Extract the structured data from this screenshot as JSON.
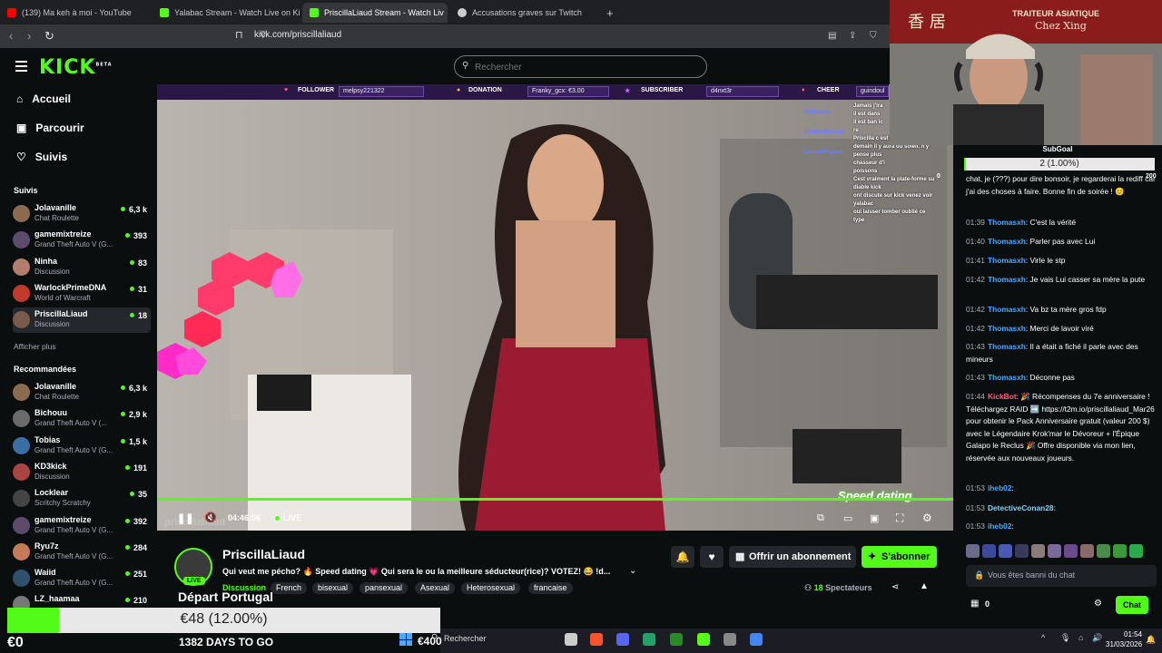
{
  "browser": {
    "tabs": [
      {
        "label": "(139) Ma keh à moi - YouTube",
        "color": "#ff0000"
      },
      {
        "label": "Yalabac Stream - Watch Live on Kick",
        "color": "#53fc18"
      },
      {
        "label": "PriscillaLiaud Stream - Watch Liv",
        "color": "#53fc18"
      },
      {
        "label": "Accusations graves sur Twitch",
        "color": "#cccccc"
      }
    ],
    "url": "kick.com/priscillaliaud"
  },
  "kick": {
    "logo": "KICK",
    "logo_beta": "BETA",
    "search_placeholder": "Rechercher",
    "nav": {
      "home": "Accueil",
      "browse": "Parcourir",
      "following": "Suivis"
    },
    "following_title": "Suivis",
    "show_more": "Afficher plus",
    "recommended_title": "Recommandées",
    "following": [
      {
        "name": "Jolavanille",
        "game": "Chat Roulette",
        "viewers": "6,3 k",
        "color": "#8b6b4f"
      },
      {
        "name": "gamemixtreize",
        "game": "Grand Theft Auto V (G...",
        "viewers": "393",
        "color": "#5d4b6e"
      },
      {
        "name": "Ninha",
        "game": "Discussion",
        "viewers": "83",
        "color": "#b07e6a"
      },
      {
        "name": "WarlockPrimeDNA",
        "game": "World of Warcraft",
        "viewers": "31",
        "color": "#c0392b"
      },
      {
        "name": "PriscillaLiaud",
        "game": "Discussion",
        "viewers": "18",
        "color": "#7a5a4a"
      }
    ],
    "recommended": [
      {
        "name": "Jolavanille",
        "game": "Chat Roulette",
        "viewers": "6,3 k",
        "color": "#8b6b4f"
      },
      {
        "name": "Bichouu",
        "game": "Grand Theft Auto V (...",
        "viewers": "2,9 k",
        "color": "#6b6b6b"
      },
      {
        "name": "Tobias",
        "game": "Grand Theft Auto V (G...",
        "viewers": "1,5 k",
        "color": "#3a6ea5"
      },
      {
        "name": "KD3kick",
        "game": "Discussion",
        "viewers": "191",
        "color": "#a94442"
      },
      {
        "name": "Locklear",
        "game": "Scritchy Scratchy",
        "viewers": "35",
        "color": "#444"
      },
      {
        "name": "gamemixtreize",
        "game": "Grand Theft Auto V (G...",
        "viewers": "392",
        "color": "#5d4b6e"
      },
      {
        "name": "Ryu7z",
        "game": "Grand Theft Auto V (G...",
        "viewers": "284",
        "color": "#c57b57"
      },
      {
        "name": "Waiid",
        "game": "Grand Theft Auto V (G...",
        "viewers": "251",
        "color": "#2f4f6f"
      },
      {
        "name": "LZ_haamaa",
        "game": "",
        "viewers": "210",
        "color": "#777"
      }
    ]
  },
  "video": {
    "alerts": {
      "follower_label": "FOLLOWER",
      "follower_value": "melpsy221322",
      "donation_label": "DONATION",
      "donation_value": "Franky_gcx: €3.00",
      "subscriber_label": "SUBSCRIBER",
      "subscriber_value": "d4nxt3r",
      "cheer_label": "CHEER",
      "cheer_value": "guindoul"
    },
    "time": "04:46:06",
    "live": "LIVE",
    "watermark": "priscillaliaud",
    "speed_dating": "Speed dating",
    "overlay_chat": [
      "Jamais j'ira",
      "il est dans",
      "il est ban ic",
      "re",
      "Priscilla c est la vie",
      "demain il y aura du soleil. n'y",
      "pense plus",
      "chasseur d'i",
      "poissons",
      "Cest vraiment la plate-forme su",
      "diable kick",
      "ont discute sur kick venez voir",
      "yalabac",
      "oui laisser tomber oublié ce",
      "type"
    ],
    "overlay_users": [
      "Multilivers",
      "JohnMcReason",
      "CaptainPegase"
    ],
    "progress": 1.0
  },
  "stream": {
    "name": "PriscillaLiaud",
    "live_badge": "LIVE",
    "title": "Qui veut me pécho? 🔥 Speed dating 💗 Qui sera le ou la meilleure séducteur(rice)? VOTEZ! 😂 !d...",
    "category": "Discussion",
    "tags": [
      "French",
      "bisexual",
      "pansexual",
      "Asexual",
      "Heterosexual",
      "francaise"
    ],
    "gift_label": "Offrir un abonnement",
    "subscribe_label": "S'abonner",
    "viewers": "18",
    "viewers_label": "Spectateurs"
  },
  "subgoal": {
    "title": "SubGoal",
    "value": "2 (1.00%)",
    "max": "200",
    "min": "0",
    "fraction": 0.01
  },
  "chat": {
    "messages": [
      {
        "time": "",
        "user": "",
        "text": "chat, je (???) pour dire bonsoir, je regarderai la rediff car j'ai des choses à faire. Bonne fin de soirée ! 😊"
      },
      {
        "time": "01:39",
        "user": "Thomasxh",
        "text": "C'est la vérité"
      },
      {
        "time": "01:40",
        "user": "Thomasxh",
        "text": "Parler pas avec Lui"
      },
      {
        "time": "01:41",
        "user": "Thomasxh",
        "text": "Virle le stp"
      },
      {
        "time": "01:42",
        "user": "Thomasxh",
        "text": "Je vais Lui casser sa mère la pute"
      },
      {
        "time": "01:42",
        "user": "Thomasxh",
        "text": "Va bz ta mère gros fdp"
      },
      {
        "time": "01:42",
        "user": "Thomasxh",
        "text": "Merci de lavoir viré"
      },
      {
        "time": "01:43",
        "user": "Thomasxh",
        "text": "Il a était a fiché il parle avec des mineurs"
      },
      {
        "time": "01:43",
        "user": "Thomasxh",
        "text": "Déconne pas"
      },
      {
        "time": "01:44",
        "user": "KickBot",
        "text": "🎉 Récompenses du 7e anniversaire ! Téléchargez RAID ➡️ https://t2m.io/priscillaliaud_Mar26 pour obtenir le Pack Anniversaire gratuit (valeur 200 $) avec le Légendaire Krok'mar le Dévoreur + l'Épique Galapo le Reclus 🎉 Offre disponible via mon lien, réservée aux nouveaux joueurs."
      },
      {
        "time": "01:53",
        "user": "iheb02",
        "text": ""
      },
      {
        "time": "01:53",
        "user": "DetectiveConan28",
        "text": ""
      },
      {
        "time": "01:53",
        "user": "iheb02",
        "text": ""
      }
    ],
    "banned_text": "Vous êtes banni du chat",
    "points": "0",
    "send_label": "Chat"
  },
  "overlay": {
    "goal_text": "€48 (12.00%)",
    "goal_fraction": 0.12,
    "goal_start": "€0",
    "days": "1382 DAYS TO GO",
    "depart": "Départ Portugal",
    "goal_end": "€400"
  },
  "taskbar": {
    "search": "Rechercher",
    "time": "01:54",
    "date": "31/03/2026"
  },
  "webcam": {
    "sign1": "香 居",
    "sign2": "TRAITEUR ASIATIQUE",
    "sign3": "Chez Xing"
  }
}
